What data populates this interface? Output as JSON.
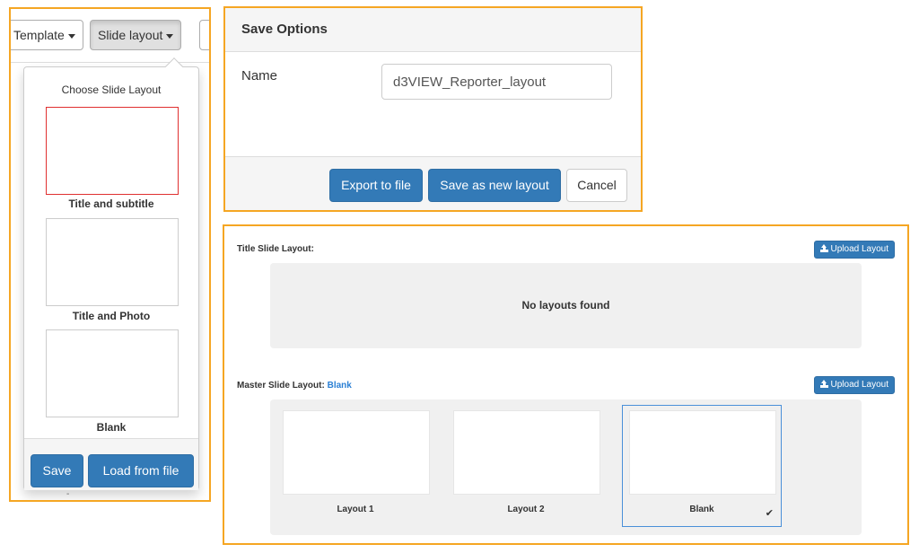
{
  "toolbar": {
    "template_label": "Template",
    "slide_layout_label": "Slide layout"
  },
  "layout_dropdown": {
    "title": "Choose Slide Layout",
    "layouts": [
      {
        "label": "Title and subtitle"
      },
      {
        "label": "Title and Photo"
      },
      {
        "label": "Blank"
      }
    ],
    "save_label": "Save",
    "load_label": "Load from file",
    "below_mark": "-"
  },
  "save_options": {
    "title": "Save Options",
    "name_label": "Name",
    "name_value": "d3VIEW_Reporter_layout",
    "export_label": "Export to file",
    "save_new_label": "Save as new layout",
    "cancel_label": "Cancel"
  },
  "layouts_panel": {
    "title_section": {
      "label": "Title Slide Layout:",
      "upload_label": "Upload Layout",
      "empty_message": "No layouts found"
    },
    "master_section": {
      "label": "Master Slide Layout:",
      "current": "Blank",
      "upload_label": "Upload Layout",
      "cards": [
        {
          "label": "Layout 1"
        },
        {
          "label": "Layout 2"
        },
        {
          "label": "Blank",
          "check": "✔"
        }
      ]
    }
  },
  "colors": {
    "highlight_border": "#f5a623",
    "primary": "#337ab7",
    "selected_layout_border": "#e03030",
    "selected_card_border": "#4a90d9"
  }
}
